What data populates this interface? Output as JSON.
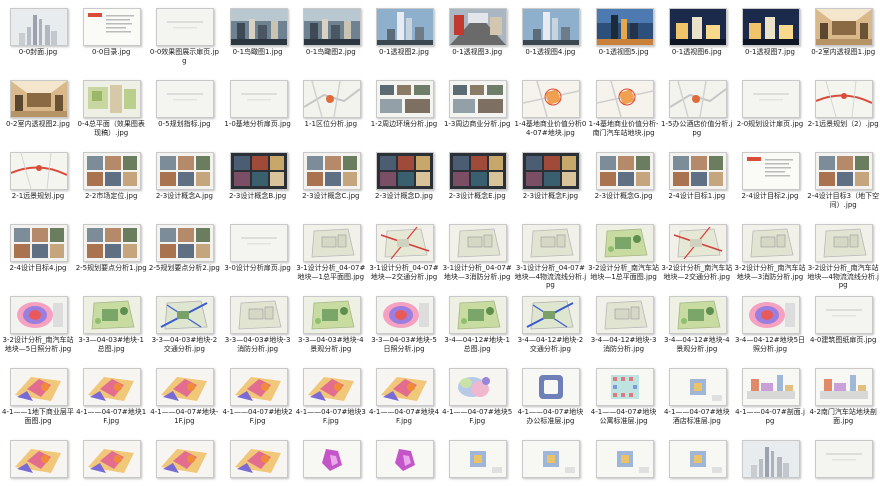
{
  "files": [
    {
      "name": "0-0封面.jpg",
      "kind": "city-light"
    },
    {
      "name": "0-0目录.jpg",
      "kind": "doc"
    },
    {
      "name": "0-0效果图展示扉页.jpg",
      "kind": "blank"
    },
    {
      "name": "0-1鸟瞰图1.jpg",
      "kind": "aerial"
    },
    {
      "name": "0-1鸟瞰图2.jpg",
      "kind": "aerial"
    },
    {
      "name": "0-1透视图2.jpg",
      "kind": "tower"
    },
    {
      "name": "0-1透视图3.jpg",
      "kind": "street"
    },
    {
      "name": "0-1透视图4.jpg",
      "kind": "tower"
    },
    {
      "name": "0-1透视图5.jpg",
      "kind": "dusk"
    },
    {
      "name": "0-1透视图6.jpg",
      "kind": "night"
    },
    {
      "name": "0-1透视图7.jpg",
      "kind": "night"
    },
    {
      "name": "0-2室内透视图1.jpg",
      "kind": "interior"
    },
    {
      "name": "0-2室内透视图2.jpg",
      "kind": "interior"
    },
    {
      "name": "0-4总平面（效果图表现稿）.jpg",
      "kind": "plan-color"
    },
    {
      "name": "0-5规划指标.jpg",
      "kind": "blank"
    },
    {
      "name": "1-0基地分析扉页.jpg",
      "kind": "blank"
    },
    {
      "name": "1-1区位分析.jpg",
      "kind": "map"
    },
    {
      "name": "1-2周边环境分析.jpg",
      "kind": "photos"
    },
    {
      "name": "1-3周边商业分析.jpg",
      "kind": "photos"
    },
    {
      "name": "1-4基地商业价值分析04-07#地块.jpg",
      "kind": "map-orange"
    },
    {
      "name": "1-4基地商业价值分析-南门汽车站地块.jpg",
      "kind": "map-orange"
    },
    {
      "name": "1-5办公酒店价值分析.jpg",
      "kind": "map"
    },
    {
      "name": "2-0规划设计扉页.jpg",
      "kind": "blank"
    },
    {
      "name": "2-1远景规划（2）.jpg",
      "kind": "map-red"
    },
    {
      "name": "2-1远景规划.jpg",
      "kind": "map-red"
    },
    {
      "name": "2-2市场定位.jpg",
      "kind": "collage"
    },
    {
      "name": "2-3设计概念A.jpg",
      "kind": "collage"
    },
    {
      "name": "2-3设计概念B.jpg",
      "kind": "collage-dark"
    },
    {
      "name": "2-3设计概念C.jpg",
      "kind": "collage"
    },
    {
      "name": "2-3设计概念D.jpg",
      "kind": "collage-dark"
    },
    {
      "name": "2-3设计概念E.jpg",
      "kind": "collage-dark"
    },
    {
      "name": "2-3设计概念F.jpg",
      "kind": "collage-dark"
    },
    {
      "name": "2-3设计概念G.jpg",
      "kind": "collage"
    },
    {
      "name": "2-4设计目标1.jpg",
      "kind": "collage"
    },
    {
      "name": "2-4设计目标2.jpg",
      "kind": "doc"
    },
    {
      "name": "2-4设计目标3（地下空间）.jpg",
      "kind": "collage"
    },
    {
      "name": "2-4设计目标4.jpg",
      "kind": "collage"
    },
    {
      "name": "2-5规划要点分析1.jpg",
      "kind": "collage"
    },
    {
      "name": "2-5规划要点分析2.jpg",
      "kind": "collage"
    },
    {
      "name": "3-0设计分析扉页.jpg",
      "kind": "blank"
    },
    {
      "name": "3-1设计分析_04-07#地块—1总平面图.jpg",
      "kind": "site-plan"
    },
    {
      "name": "3-1设计分析_04-07#地块—2交通分析.jpg",
      "kind": "site-red"
    },
    {
      "name": "3-1设计分析_04-07#地块—3消防分析.jpg",
      "kind": "site-plan"
    },
    {
      "name": "3-1设计分析_04-07#地块—4物流流线分析.jpg",
      "kind": "site-plan"
    },
    {
      "name": "3-2设计分析_南汽车站地块—1总平面图.jpg",
      "kind": "site-green"
    },
    {
      "name": "3-2设计分析_南汽车站地块—2交通分析.jpg",
      "kind": "site-red"
    },
    {
      "name": "3-2设计分析_南汽车站地块—3消防分析.jpg",
      "kind": "site-plan"
    },
    {
      "name": "3-2设计分析_南汽车站地块—4物流流线分析.jpg",
      "kind": "site-plan"
    },
    {
      "name": "3-2设计分析_南汽车站地块—5日照分析.jpg",
      "kind": "sun"
    },
    {
      "name": "3-3—04-03#地块-1总图.jpg",
      "kind": "site-green"
    },
    {
      "name": "3-3—04-03#地块-2交通分析.jpg",
      "kind": "site-blue"
    },
    {
      "name": "3-3—04-03#地块-3消防分析.jpg",
      "kind": "site-plan"
    },
    {
      "name": "3-3—04-03#地块-4景观分析.jpg",
      "kind": "site-green"
    },
    {
      "name": "3-3—04-03#地块-5日照分析.jpg",
      "kind": "sun"
    },
    {
      "name": "3-4—04-12#地块-1总图.jpg",
      "kind": "site-green"
    },
    {
      "name": "3-4—04-12#地块-2交通分析.jpg",
      "kind": "site-blue"
    },
    {
      "name": "3-4—04-12#地块-3消防分析.jpg",
      "kind": "site-plan"
    },
    {
      "name": "3-4—04-12#地块-4景观分析.jpg",
      "kind": "site-green"
    },
    {
      "name": "3-4—04-12#地块5日照分析.jpg",
      "kind": "sun"
    },
    {
      "name": "4-0建筑图纸扉页.jpg",
      "kind": "blank"
    },
    {
      "name": "4-1——1地下商业层平面图.jpg",
      "kind": "floor-color"
    },
    {
      "name": "4-1——04-07#地块1F.jpg",
      "kind": "floor-color"
    },
    {
      "name": "4-1——04-07#地块-1F.jpg",
      "kind": "floor-color"
    },
    {
      "name": "4-1——04-07#地块2F.jpg",
      "kind": "floor-color"
    },
    {
      "name": "4-1——04-07#地块3F.jpg",
      "kind": "floor-color"
    },
    {
      "name": "4-1——04-07#地块4F.jpg",
      "kind": "floor-color"
    },
    {
      "name": "4-1——04-07#地块5F.jpg",
      "kind": "floor-pastel"
    },
    {
      "name": "4-1——04-07#地块办公标准层.jpg",
      "kind": "floor-ring"
    },
    {
      "name": "4-1——04-07#地块公寓标准层.jpg",
      "kind": "floor-grid"
    },
    {
      "name": "4-1——04-07#地块酒店标准层.jpg",
      "kind": "floor-small"
    },
    {
      "name": "4-1——04-07#剖面.jpg",
      "kind": "section"
    },
    {
      "name": "4-2南门汽车站地块剖面.jpg",
      "kind": "section"
    },
    {
      "name": "",
      "kind": "floor-color"
    },
    {
      "name": "",
      "kind": "floor-color"
    },
    {
      "name": "",
      "kind": "floor-color"
    },
    {
      "name": "",
      "kind": "floor-color"
    },
    {
      "name": "",
      "kind": "floor-purple"
    },
    {
      "name": "",
      "kind": "floor-purple"
    },
    {
      "name": "",
      "kind": "floor-small"
    },
    {
      "name": "",
      "kind": "floor-small"
    },
    {
      "name": "",
      "kind": "floor-small"
    },
    {
      "name": "",
      "kind": "floor-small"
    },
    {
      "name": "",
      "kind": "city-light"
    },
    {
      "name": "",
      "kind": "blank"
    }
  ],
  "colors": {
    "background": "#ffffff",
    "caption": "#1a1a1a",
    "thumb_border": "#c9c9c9"
  }
}
